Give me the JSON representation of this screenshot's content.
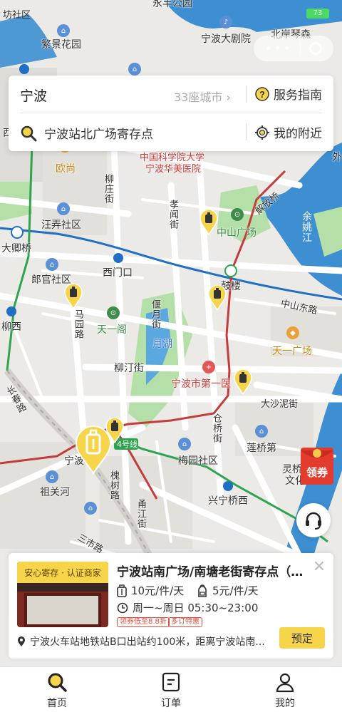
{
  "status_bar": {
    "left_text": "坊社区",
    "battery": "73"
  },
  "search": {
    "city": "宁波",
    "city_count": "33座城市",
    "guide_label": "服务指南",
    "query": "宁波站北广场寄存点",
    "nearby_label": "我的附近"
  },
  "map": {
    "labels": {
      "fanjing": "繁景花园",
      "ningbo_theatre": "宁波大剧院",
      "beian": "北岸琴森",
      "yongfeng": "永丰公园",
      "ouchang": "欧尚",
      "cas": "中国科学院大学",
      "huamei": "宁波华美医院",
      "liuzhuang": "柳庄街",
      "xiaomen": "孝闻街",
      "wangnong": "汪弄社区",
      "zhongshan_sq": "中山广场",
      "jiefang_rd": "解放桥",
      "yuyao": "余姚江",
      "daqing": "大卿桥",
      "ximen": "西门口",
      "langguan": "郎官社区",
      "gulou": "鼓楼",
      "zhongshan_e": "中山东路",
      "liuxi": "柳西",
      "mayuan": "马园路",
      "tianyige": "天一阁",
      "yuehu_st": "偃月街",
      "yuehu": "月湖",
      "tianyi_sq": "天一广场",
      "liuting": "柳汀街",
      "first_hosp": "宁波市第一医",
      "dashani": "大沙泥街",
      "cangqiao": "仓桥街",
      "lianqiao": "莲桥第",
      "zuguanshan": "祖关河",
      "meiyuan": "梅园社区",
      "xingning": "兴宁桥西",
      "lingqiao": "灵桥",
      "wenchang": "文化",
      "changchun": "长春路",
      "yongjiang": "甬江街",
      "sanshi": "三市路",
      "huaishu": "槐树路",
      "ningbo_short": "宁波",
      "line4": "4号线",
      "left_edge": "西",
      "right_edge": "外"
    }
  },
  "coupon": {
    "label": "领券"
  },
  "store": {
    "badge": "安心寄存 · 认证商家",
    "name": "宁波站南广场/南塘老街寄存点（面...",
    "price_luggage": "10元/件/天",
    "price_bag": "5元/件/天",
    "hours": "周一~周日 05:30~23:00",
    "tags": [
      "领券低至8.8折",
      "多订特惠"
    ],
    "address": "宁波火车站地铁站B口出站约100米，距离宁波站南...",
    "book_label": "预定"
  },
  "tabs": [
    {
      "label": "首页",
      "icon": "search-icon",
      "active": true
    },
    {
      "label": "订单",
      "icon": "order-icon",
      "active": false
    },
    {
      "label": "我的",
      "icon": "user-icon",
      "active": false
    }
  ],
  "colors": {
    "accent": "#f7d54a",
    "metro_blue": "#1f6fc5",
    "metro_red": "#c53b3b",
    "metro_green": "#2ea44f",
    "river": "#2f84c8",
    "park": "#a8d8a0"
  }
}
